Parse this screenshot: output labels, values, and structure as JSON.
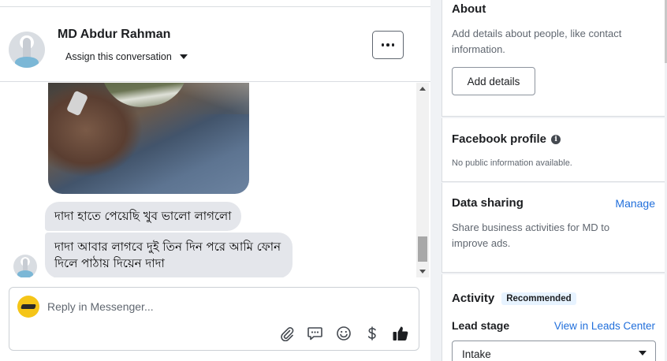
{
  "chat": {
    "contact_name": "MD Abdur Rahman",
    "assign_label": "Assign this conversation",
    "more_label": "More options",
    "messages": [
      {
        "type": "image",
        "description": "photo"
      },
      {
        "type": "text",
        "text": "দাদা হাতে পেয়েছি খুব ভালো লাগলো"
      },
      {
        "type": "text",
        "text": "দাদা আবার লাগবে দুই তিন দিন পরে  আমি ফোন দিলে পাঠায় দিয়েন দাদা"
      }
    ],
    "reply_placeholder": "Reply in Messenger...",
    "tools": [
      "paperclip-icon",
      "saved-reply-icon",
      "emoji-icon",
      "dollar-icon",
      "thumbs-up-icon"
    ]
  },
  "sidebar": {
    "about": {
      "title": "About",
      "description": "Add details about people, like contact information.",
      "button": "Add details"
    },
    "facebook_profile": {
      "title": "Facebook profile",
      "description": "No public information available."
    },
    "data_sharing": {
      "title": "Data sharing",
      "link": "Manage",
      "description": "Share business activities for MD to improve ads."
    },
    "activity": {
      "title": "Activity",
      "badge": "Recommended",
      "lead_stage_label": "Lead stage",
      "leads_link": "View in Leads Center",
      "lead_stage_value": "Intake"
    }
  },
  "colors": {
    "link": "#216fdb",
    "bubble": "#e4e6eb",
    "panel_bg": "#f0f2f5",
    "like": "#1c1e21",
    "page_logo": "#f5c518"
  }
}
